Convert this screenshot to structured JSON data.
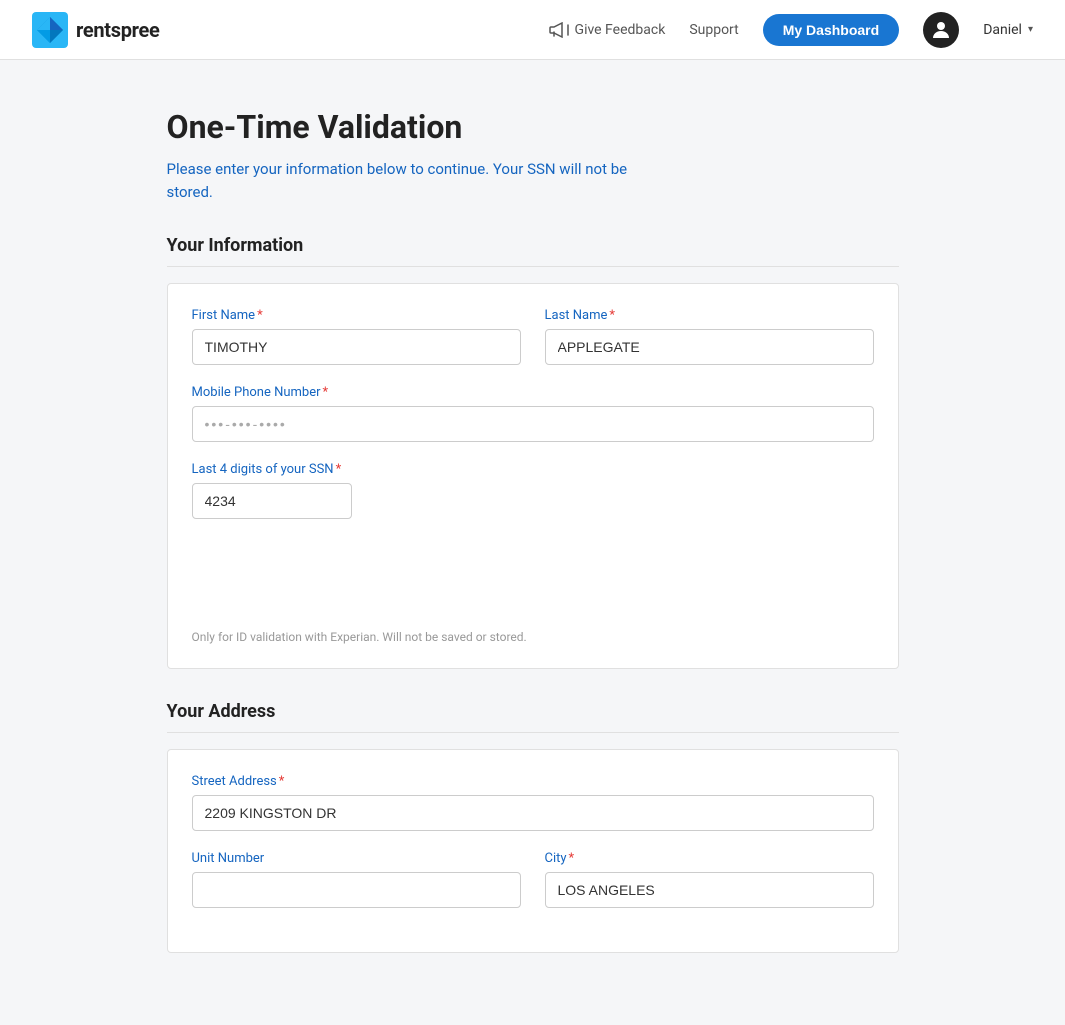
{
  "header": {
    "logo_text_plain": "rent",
    "logo_text_bold": "spree",
    "feedback_label": "Give Feedback",
    "support_label": "Support",
    "dashboard_label": "My Dashboard",
    "user_name": "Daniel"
  },
  "page": {
    "title": "One-Time Validation",
    "subtitle": "Please enter your information below to continue. Your SSN will not be stored."
  },
  "your_information": {
    "section_title": "Your Information",
    "first_name_label": "First Name",
    "first_name_value": "TIMOTHY",
    "last_name_label": "Last Name",
    "last_name_value": "APPLEGATE",
    "phone_label": "Mobile Phone Number",
    "phone_placeholder": "•••-•••-••••",
    "ssn_label": "Last 4 digits of your SSN",
    "ssn_value": "4234",
    "ssn_hint": "Only for ID validation with Experian. Will not be saved or stored."
  },
  "your_address": {
    "section_title": "Your Address",
    "street_label": "Street Address",
    "street_value": "2209 KINGSTON DR",
    "unit_label": "Unit Number",
    "unit_value": "",
    "city_label": "City",
    "city_value": "LOS ANGELES"
  }
}
